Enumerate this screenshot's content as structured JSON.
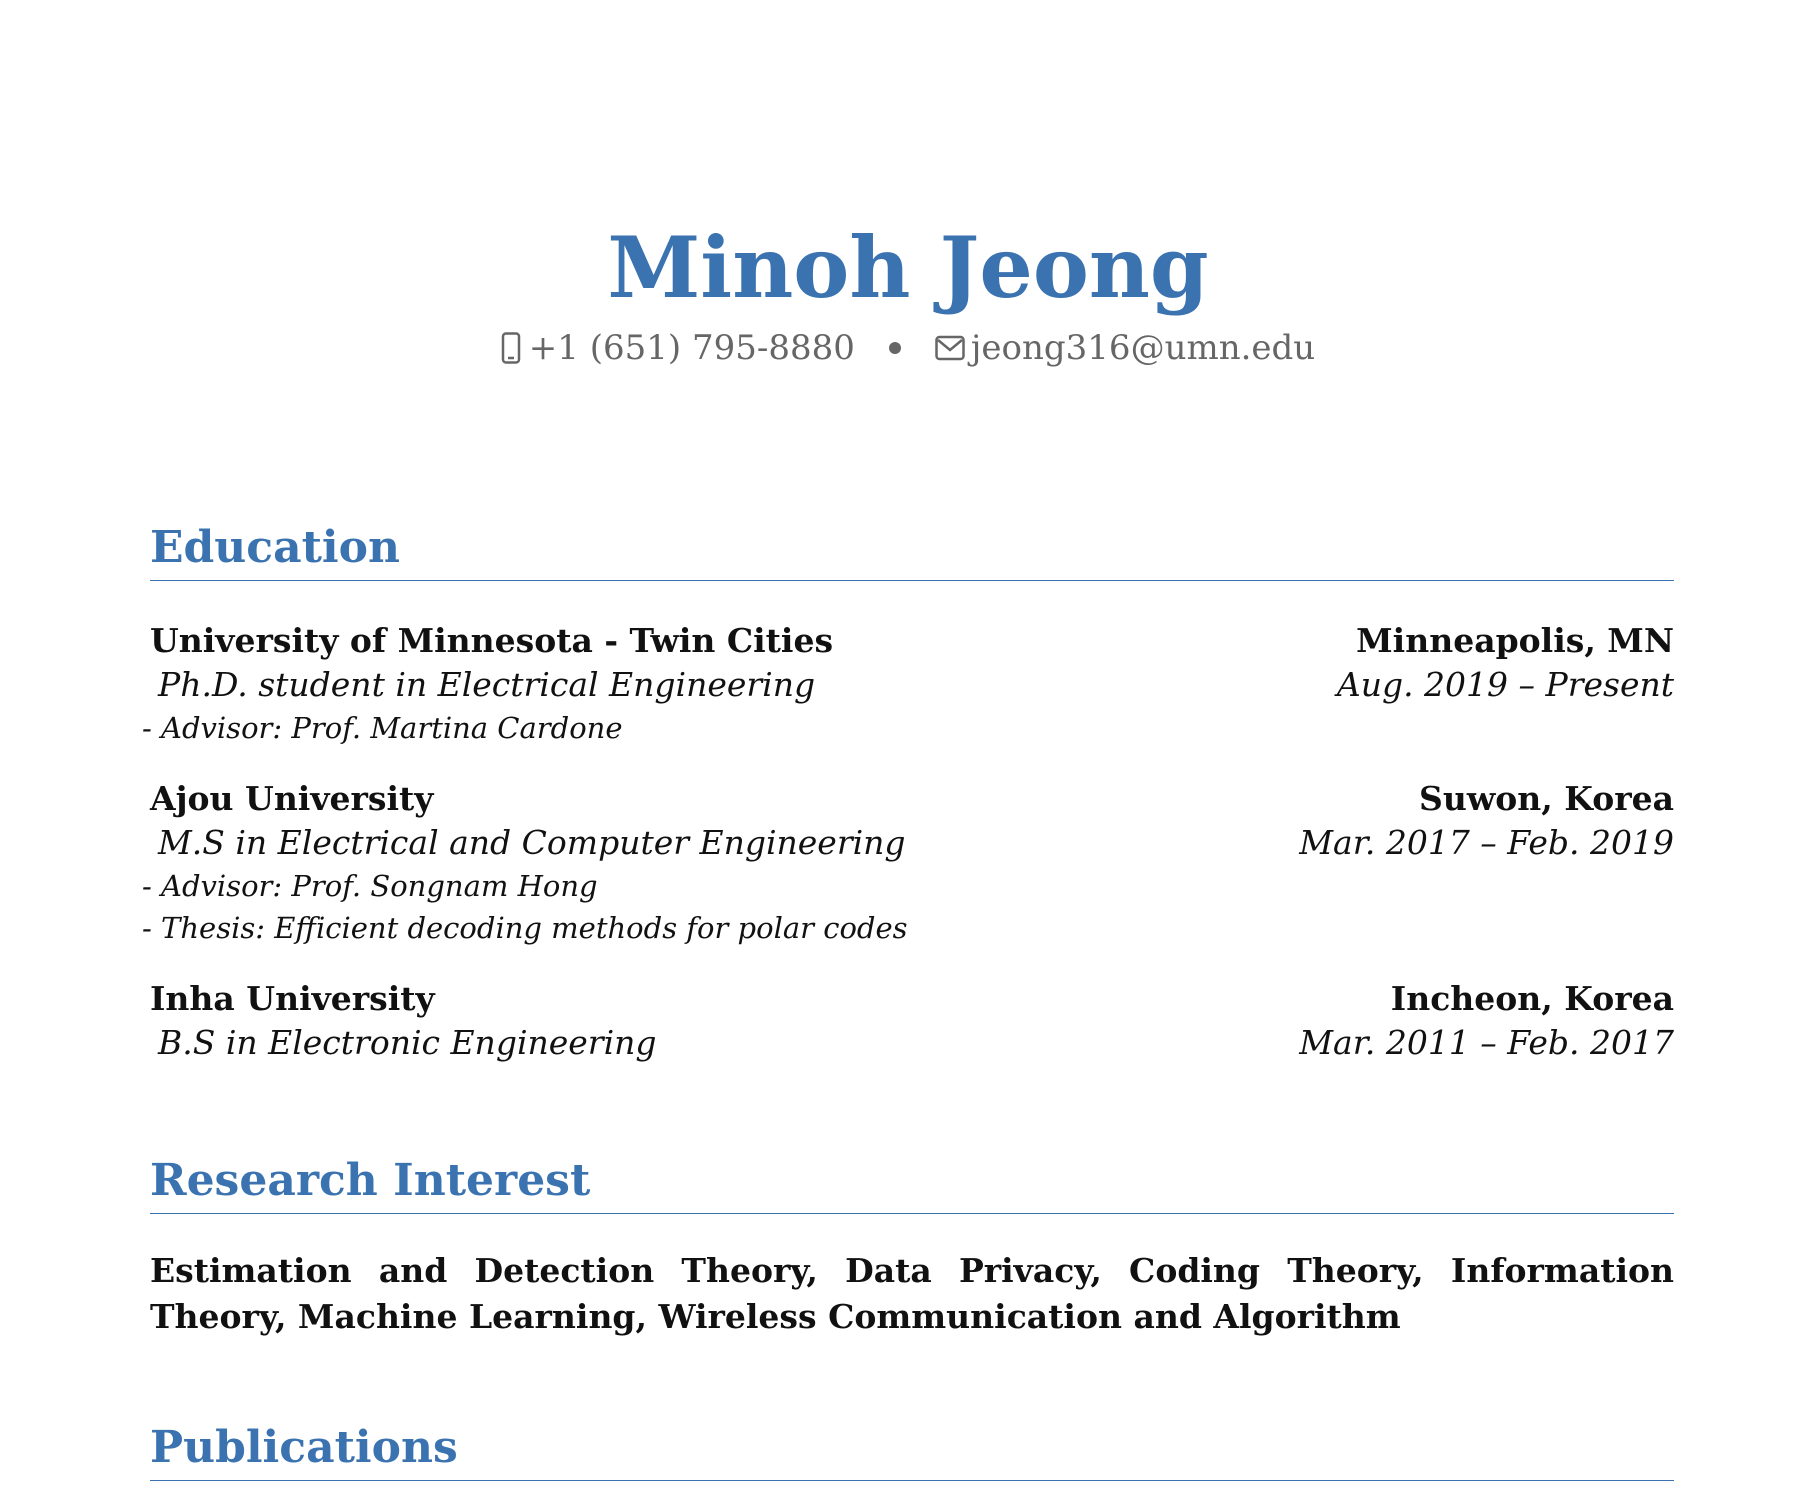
{
  "header": {
    "name": "Minoh Jeong",
    "phone_icon": "mobile-phone-icon",
    "phone": "+1 (651) 795-8880",
    "email_icon": "envelope-icon",
    "email": "jeong316@umn.edu"
  },
  "sections": {
    "education": {
      "title": "Education",
      "entries": [
        {
          "institution": "University of Minnesota - Twin Cities",
          "location": "Minneapolis, MN",
          "degree": "Ph.D. student in Electrical Engineering",
          "dates": "Aug. 2019 – Present",
          "details": [
            "- Advisor: Prof. Martina Cardone"
          ]
        },
        {
          "institution": "Ajou University",
          "location": "Suwon, Korea",
          "degree": "M.S in Electrical and Computer Engineering",
          "dates": "Mar. 2017 – Feb. 2019",
          "details": [
            "- Advisor: Prof. Songnam Hong",
            "- Thesis: Efficient decoding methods for polar codes"
          ]
        },
        {
          "institution": "Inha University",
          "location": "Incheon, Korea",
          "degree": "B.S in Electronic Engineering",
          "dates": "Mar. 2011 – Feb. 2017",
          "details": []
        }
      ]
    },
    "research": {
      "title": "Research Interest",
      "text": "Estimation and Detection Theory, Data Privacy, Coding Theory, Information Theory, Machine Learning, Wireless Communication and Algorithm"
    },
    "publications": {
      "title": "Publications"
    }
  },
  "colors": {
    "accent": "#3b73b1",
    "contact_text": "#666666",
    "body_text": "#111111"
  }
}
